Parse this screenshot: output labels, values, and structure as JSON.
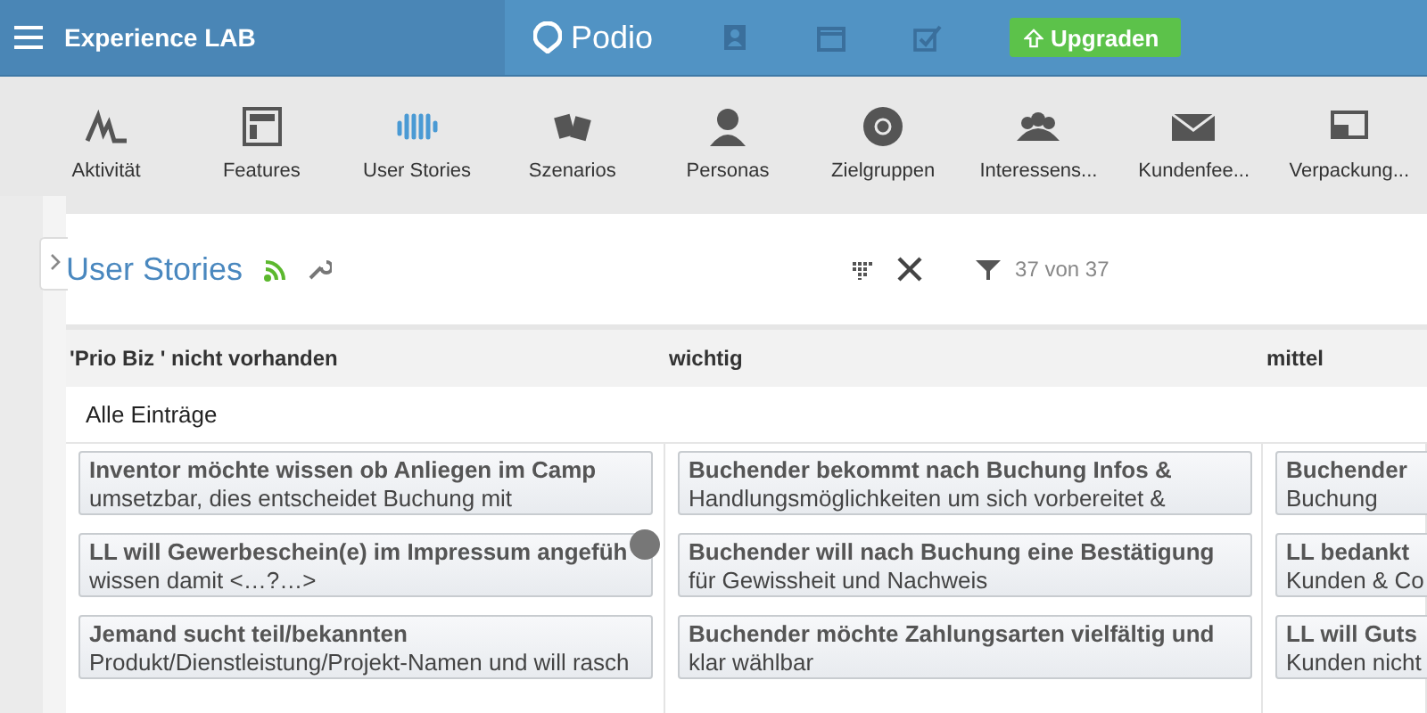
{
  "topbar": {
    "workspace": "Experience LAB",
    "logo": "Podio",
    "upgrade": "Upgraden"
  },
  "nav": [
    {
      "label": "Aktivität",
      "kind": "activity",
      "selected": false
    },
    {
      "label": "Features",
      "kind": "layout",
      "selected": false
    },
    {
      "label": "User Stories",
      "kind": "wave",
      "selected": true
    },
    {
      "label": "Szenarios",
      "kind": "cards",
      "selected": false
    },
    {
      "label": "Personas",
      "kind": "person",
      "selected": false
    },
    {
      "label": "Zielgruppen",
      "kind": "target",
      "selected": false
    },
    {
      "label": "Interessens...",
      "kind": "group",
      "selected": false
    },
    {
      "label": "Kundenfee...",
      "kind": "mail",
      "selected": false
    },
    {
      "label": "Verpackung...",
      "kind": "screens",
      "selected": false
    }
  ],
  "app": {
    "title": "User Stories",
    "count": "37 von 37"
  },
  "group": "Alle Einträge",
  "columns": [
    {
      "heading": "'Prio Biz ' nicht vorhanden",
      "cards": [
        {
          "title": "Inventor möchte wissen ob Anliegen im Camp",
          "text": "umsetzbar, dies entscheidet Buchung mit"
        },
        {
          "title": "LL will Gewerbeschein(e) im Impressum angefüh",
          "text": "wissen damit <…?…>",
          "avatar": true
        },
        {
          "title": "Jemand sucht teil/bekannten",
          "text": "Produkt/Dienstleistung/Projekt-Namen und will rasch"
        }
      ]
    },
    {
      "heading": "wichtig",
      "cards": [
        {
          "title": "Buchender bekommt nach Buchung Infos &",
          "text": "Handlungsmöglichkeiten um sich vorbereitet &"
        },
        {
          "title": "Buchender will nach Buchung eine Bestätigung",
          "text": "für Gewissheit und Nachweis"
        },
        {
          "title": "Buchender möchte Zahlungsarten vielfältig und",
          "text": "klar wählbar"
        }
      ]
    },
    {
      "heading": "mittel",
      "cards": [
        {
          "title": "Buchender",
          "text": "Buchung"
        },
        {
          "title": "LL bedankt",
          "text": "Kunden & Co"
        },
        {
          "title": "LL will Guts",
          "text": "Kunden nicht"
        }
      ]
    }
  ]
}
